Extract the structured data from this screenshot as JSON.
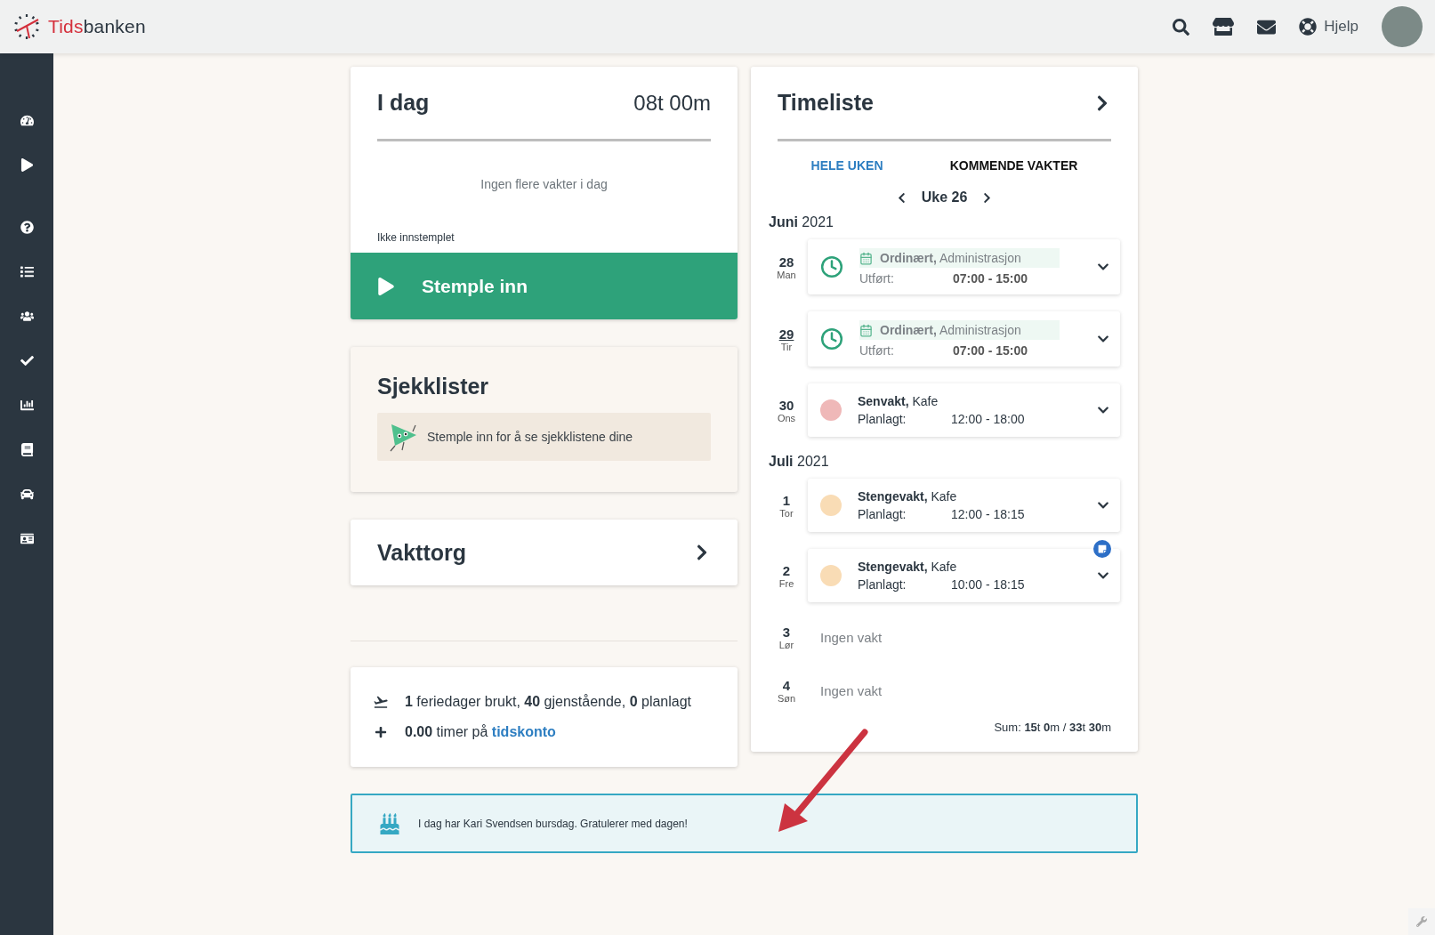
{
  "header": {
    "logo": {
      "accent": "Tids",
      "rest": "banken"
    },
    "help_label": "Hjelp"
  },
  "today_card": {
    "title": "I dag",
    "duration": "08t 00m",
    "message": "Ingen flere vakter i dag",
    "status": "Ikke innstemplet",
    "clock_in_button": "Stemple inn"
  },
  "checklists_card": {
    "title": "Sjekklister",
    "message": "Stemple inn for å se sjekklistene dine"
  },
  "shift_market_card": {
    "title": "Vakttorg"
  },
  "balance_card": {
    "vacation": "**1** feriedager brukt, **40** gjenstående, **0** planlagt",
    "account_prefix": "**0.00** timer på",
    "account_link": "tidskonto"
  },
  "timesheet": {
    "title": "Timeliste",
    "tabs": [
      {
        "label": "HELE UKEN",
        "selected": true
      },
      {
        "label": "KOMMENDE VAKTER",
        "selected": false
      }
    ],
    "week": "Uke 26",
    "months": [
      {
        "label": "**Juni** 2021",
        "days": [
          {
            "date": "28",
            "weekday": "Man",
            "today": false,
            "note": false,
            "shift": {
              "kind": "worked",
              "title": "**Ordinært,** Administrasjon",
              "label": "Utført:",
              "time": "07:00 - 15:00"
            }
          },
          {
            "date": "29",
            "weekday": "Tir",
            "today": true,
            "note": false,
            "shift": {
              "kind": "worked",
              "title": "**Ordinært,** Administrasjon",
              "label": "Utført:",
              "time": "07:00 - 15:00"
            }
          },
          {
            "date": "30",
            "weekday": "Ons",
            "today": false,
            "note": false,
            "shift": {
              "kind": "planned",
              "color": "#efb8b8",
              "title": "**Senvakt,** Kafe",
              "label": "Planlagt:",
              "time": "12:00 - 18:00"
            }
          }
        ]
      },
      {
        "label": "**Juli** 2021",
        "days": [
          {
            "date": "1",
            "weekday": "Tor",
            "today": false,
            "note": false,
            "shift": {
              "kind": "planned",
              "color": "#f9dcb5",
              "title": "**Stengevakt,** Kafe",
              "label": "Planlagt:",
              "time": "12:00 - 18:15"
            }
          },
          {
            "date": "2",
            "weekday": "Fre",
            "today": false,
            "note": true,
            "shift": {
              "kind": "planned",
              "color": "#f9dcb5",
              "title": "**Stengevakt,** Kafe",
              "label": "Planlagt:",
              "time": "10:00 - 18:15"
            }
          },
          {
            "date": "3",
            "weekday": "Lør",
            "today": false,
            "note": false,
            "empty_text": "Ingen vakt"
          },
          {
            "date": "4",
            "weekday": "Søn",
            "today": false,
            "note": false,
            "empty_text": "Ingen vakt"
          }
        ]
      }
    ],
    "sum": "Sum: **15**t **0**m / **33**t **30**m"
  },
  "birthday_banner": {
    "message": "I dag har Kari Svendsen bursdag. Gratulerer med dagen!"
  }
}
